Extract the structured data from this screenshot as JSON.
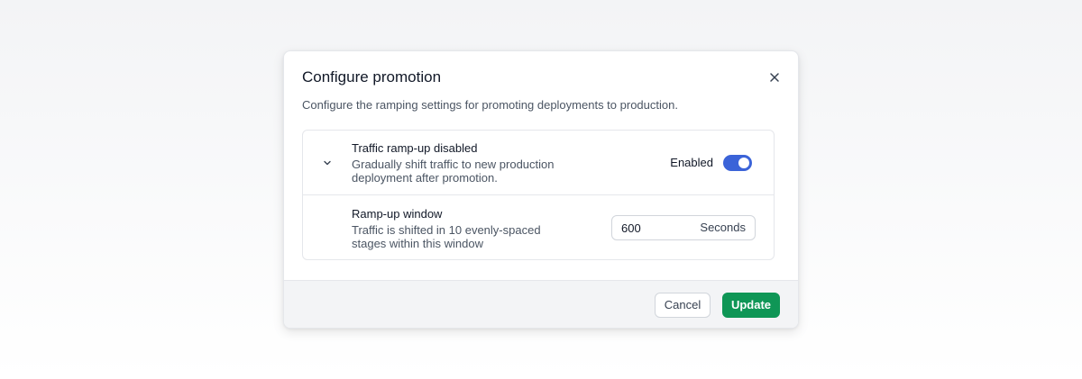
{
  "modal": {
    "title": "Configure promotion",
    "description": "Configure the ramping settings for promoting deployments to production.",
    "close_icon": "close-icon"
  },
  "ramp_up": {
    "title": "Traffic ramp-up disabled",
    "subtitle": "Gradually shift traffic to new production deployment after promotion.",
    "expand_icon": "chevron-down-icon",
    "toggle_label": "Enabled",
    "toggle_on": true,
    "toggle_color": "#3b63d8"
  },
  "window": {
    "title": "Ramp-up window",
    "subtitle": "Traffic is shifted in 10 evenly-spaced stages within this window",
    "value": "600",
    "unit": "Seconds"
  },
  "footer": {
    "cancel_label": "Cancel",
    "update_label": "Update",
    "update_color": "#0f9656"
  }
}
